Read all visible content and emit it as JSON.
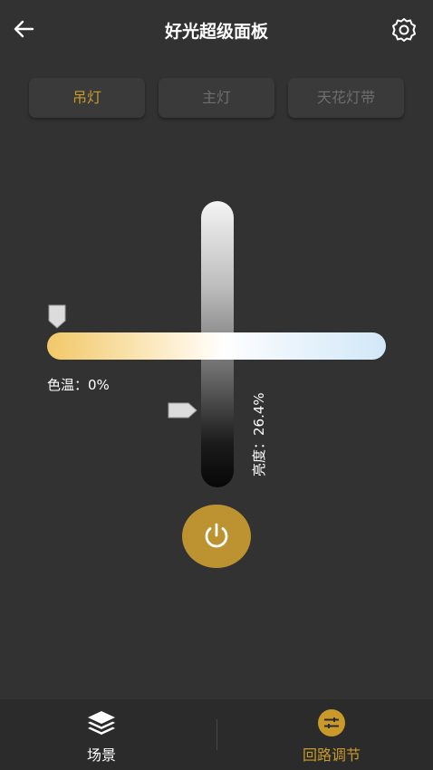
{
  "header": {
    "title": "好光超级面板",
    "back_icon": "arrow-left-icon",
    "settings_icon": "gear-icon"
  },
  "tabs": [
    {
      "label": "吊灯",
      "active": true
    },
    {
      "label": "主灯",
      "active": false
    },
    {
      "label": "天花灯带",
      "active": false
    }
  ],
  "color_temperature": {
    "label_prefix": "色温：",
    "value_text": "0%",
    "value": 0
  },
  "brightness": {
    "label": "亮度：26.4%",
    "value": 26.4
  },
  "power_button": {
    "icon": "power-icon"
  },
  "bottom_nav": {
    "items": [
      {
        "label": "场景",
        "icon": "layers-icon",
        "active": false
      },
      {
        "label": "回路调节",
        "icon": "sliders-icon",
        "active": true
      }
    ]
  },
  "colors": {
    "background": "#323232",
    "accent": "#c99a2a",
    "power_button": "#bd9230",
    "tab_background": "#3a3a3a",
    "inactive_text": "#6e6e6e",
    "warm_end": "#f2c868",
    "cool_end": "#d2e8f8"
  }
}
